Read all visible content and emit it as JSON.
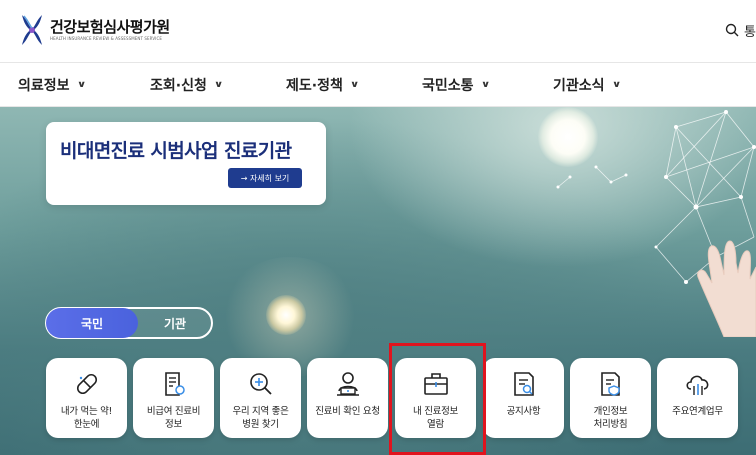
{
  "header": {
    "logo_title": "건강보험심사평가원",
    "logo_subtitle": "HEALTH INSURANCE REVIEW & ASSESSMENT SERVICE",
    "search_icon": "search-icon",
    "search_label": "통"
  },
  "gnb": {
    "items": [
      {
        "label": "의료정보",
        "icon": "chevron-down-icon"
      },
      {
        "label": "조회·신청",
        "icon": "chevron-down-icon"
      },
      {
        "label": "제도·정책",
        "icon": "chevron-down-icon"
      },
      {
        "label": "국민소통",
        "icon": "chevron-down-icon"
      },
      {
        "label": "기관소식",
        "icon": "chevron-down-icon"
      }
    ]
  },
  "promo": {
    "title": "비대면진료 시범사업 진료기관",
    "button_label": "→ 자세히 보기"
  },
  "toggle": {
    "active_label": "국민",
    "inactive_label": "기관"
  },
  "quick_menu": [
    {
      "label": "내가 먹는 약!\n한눈에",
      "icon": "pill-icon"
    },
    {
      "label": "비급여 진료비\n정보",
      "icon": "clipboard-receipt-icon"
    },
    {
      "label": "우리 지역 좋은\n병원 찾기",
      "icon": "hospital-search-icon"
    },
    {
      "label": "진료비 확인 요청",
      "icon": "doctor-laptop-icon"
    },
    {
      "label": "내 진료정보\n열람",
      "icon": "medical-bag-icon"
    },
    {
      "label": "공지사항",
      "icon": "notice-document-icon"
    },
    {
      "label": "개인정보\n처리방침",
      "icon": "privacy-document-icon"
    },
    {
      "label": "주요연계업무",
      "icon": "cloud-link-icon"
    }
  ],
  "colors": {
    "brand_navy": "#1b2f7a",
    "button_blue": "#1f3c8f",
    "toggle_active": "#4a62dd",
    "highlight_red": "#e0141e"
  }
}
